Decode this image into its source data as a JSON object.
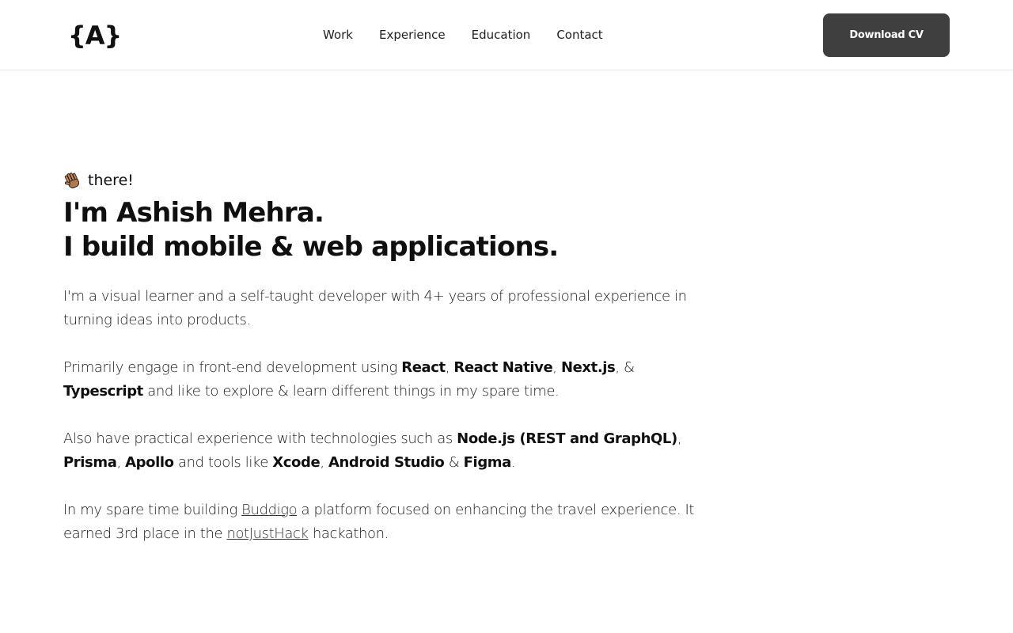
{
  "header": {
    "logo_text": "{A}",
    "nav": {
      "work": "Work",
      "experience": "Experience",
      "education": "Education",
      "contact": "Contact"
    },
    "cv_button": "Download CV"
  },
  "hero": {
    "greeting_icon": "waving-hand-icon",
    "greeting_text": "there!",
    "headline_line1": "I'm Ashish Mehra.",
    "headline_line2": "I build mobile & web applications.",
    "p1": "I'm a visual learner and a self-taught developer with 4+ years of professional experience in turning ideas into products.",
    "p2": {
      "t1": "Primarily engage in front-end development using ",
      "react": "React",
      "sep1": ", ",
      "react_native": "React Native",
      "sep2": ", ",
      "nextjs": "Next.js",
      "sep3": ", & ",
      "typescript": "Typescript",
      "t2": " and like to explore & learn different things in my spare time."
    },
    "p3": {
      "t1": "Also have practical experience with technologies such as ",
      "node": "Node.js (REST and GraphQL)",
      "sep1": ", ",
      "prisma": "Prisma",
      "sep2": ", ",
      "apollo": "Apollo",
      "t2": " and tools like ",
      "xcode": "Xcode",
      "sep3": ", ",
      "android_studio": "Android Studio",
      "sep4": " & ",
      "figma": "Figma",
      "end": "."
    },
    "p4": {
      "t1": "In my spare time building ",
      "buddigo": "Buddigo",
      "t2": " a platform focused on enhancing the travel experience. It earned 3rd place in the ",
      "notjusthack": "notJustHack",
      "t3": " hackathon."
    }
  },
  "colors": {
    "button_bg": "#3f3f3f",
    "text": "#111111",
    "border": "#e5e5e5"
  }
}
